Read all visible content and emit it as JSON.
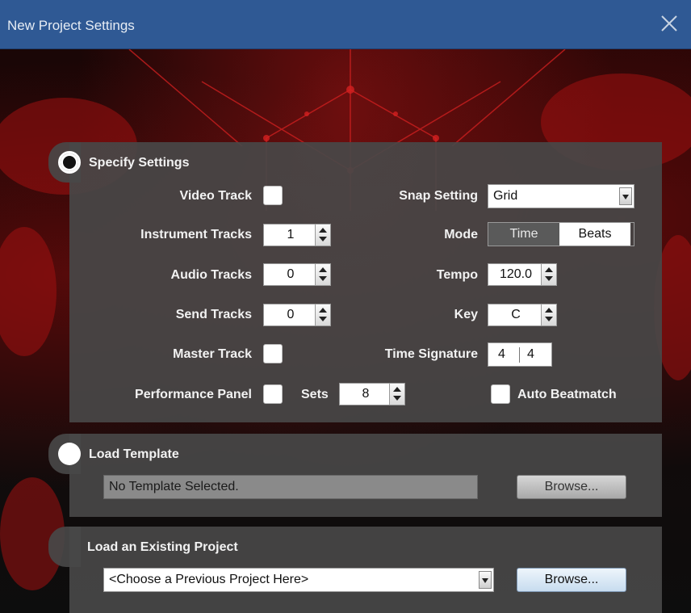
{
  "window": {
    "title": "New Project Settings"
  },
  "specify": {
    "label": "Specify Settings",
    "video_track": "Video Track",
    "instrument_tracks": {
      "label": "Instrument Tracks",
      "value": "1"
    },
    "audio_tracks": {
      "label": "Audio Tracks",
      "value": "0"
    },
    "send_tracks": {
      "label": "Send Tracks",
      "value": "0"
    },
    "master_track": "Master Track",
    "performance_panel": "Performance Panel",
    "sets": {
      "label": "Sets",
      "value": "8"
    },
    "snap_setting": {
      "label": "Snap Setting",
      "value": "Grid"
    },
    "mode": {
      "label": "Mode",
      "options": [
        "Time",
        "Beats"
      ],
      "selected": "Beats"
    },
    "tempo": {
      "label": "Tempo",
      "value": "120.0"
    },
    "key": {
      "label": "Key",
      "value": "C"
    },
    "time_signature": {
      "label": "Time Signature",
      "numerator": "4",
      "denominator": "4"
    },
    "auto_beatmatch": "Auto Beatmatch"
  },
  "template": {
    "label": "Load Template",
    "field_value": "No Template Selected.",
    "browse": "Browse..."
  },
  "existing": {
    "label": "Load an Existing Project",
    "select_value": "<Choose a Previous Project Here>",
    "browse": "Browse..."
  },
  "colors": {
    "titlebar": "#2f5994",
    "panel": "#484848",
    "accent_red": "#b01515"
  }
}
